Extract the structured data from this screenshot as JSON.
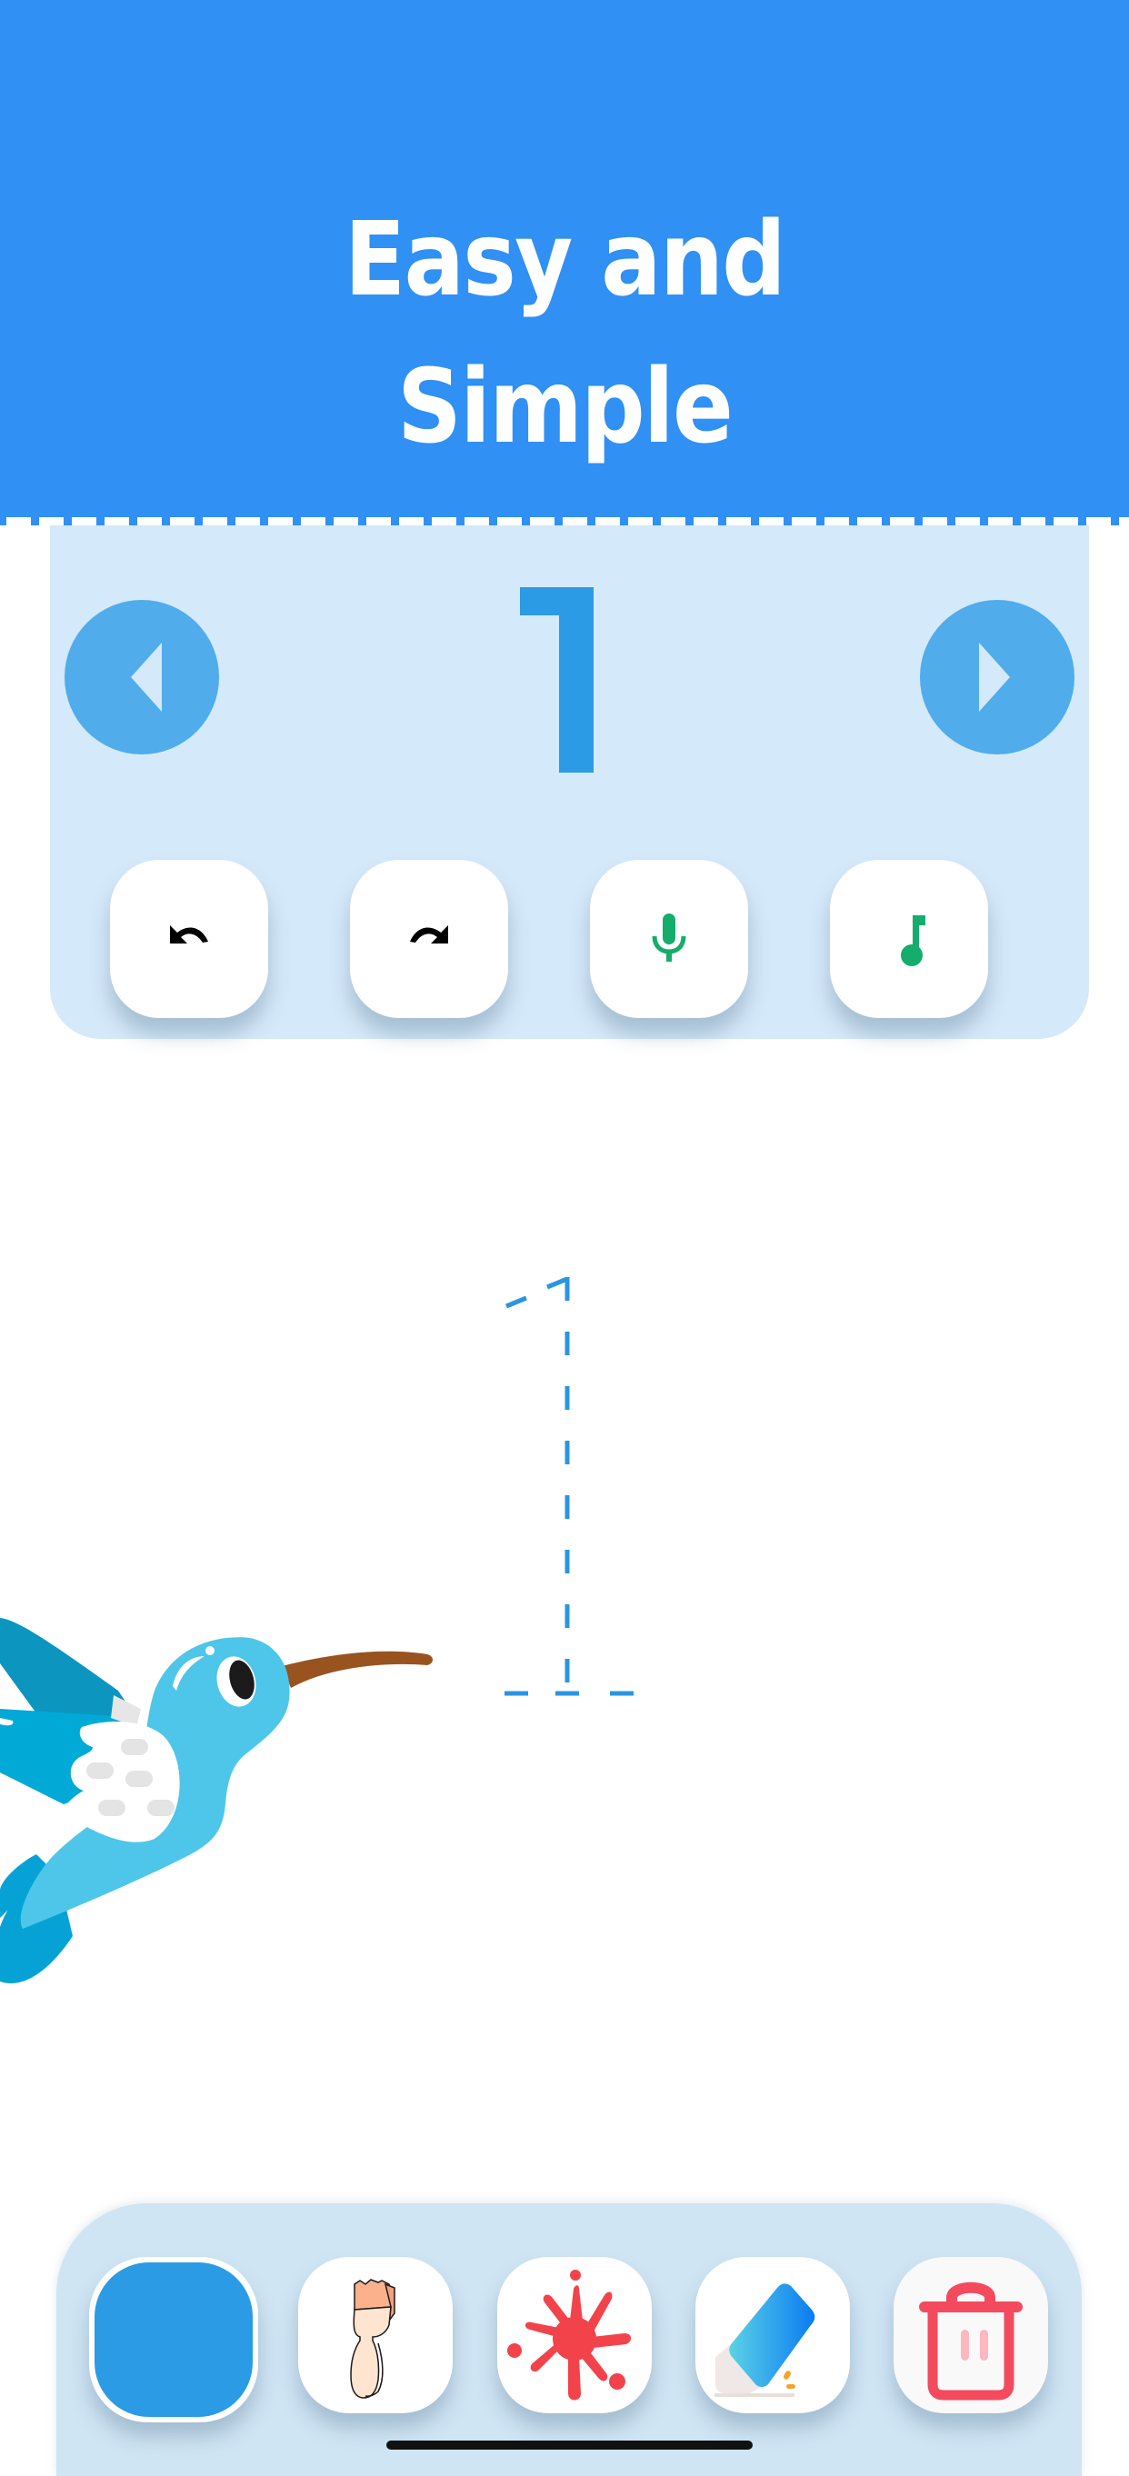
{
  "banner": {
    "title_line1": "Easy and",
    "title_line2": "Simple",
    "background_color": "#3090f4"
  },
  "number_panel": {
    "current_number": "1",
    "prev_button": {
      "icon": "triangle-left-icon",
      "label": "Previous number"
    },
    "next_button": {
      "icon": "triangle-right-icon",
      "label": "Next number"
    },
    "actions": [
      {
        "id": "undo",
        "icon": "undo-icon",
        "color": "#000000"
      },
      {
        "id": "redo",
        "icon": "redo-icon",
        "color": "#000000"
      },
      {
        "id": "voice",
        "icon": "microphone-icon",
        "color": "#14ad6b"
      },
      {
        "id": "sound",
        "icon": "music-note-icon",
        "color": "#14ad6b"
      }
    ]
  },
  "canvas": {
    "tracing_guide_digit": "1",
    "guide_color": "#2a95e0",
    "mascot": "hummingbird"
  },
  "toolbar": {
    "tools": [
      {
        "id": "color",
        "icon": "color-swatch",
        "color": "#2a9be4",
        "selected": true
      },
      {
        "id": "brush",
        "icon": "paintbrush-icon",
        "selected": false
      },
      {
        "id": "splash",
        "icon": "paint-splash-icon",
        "color": "#f2434b",
        "selected": false
      },
      {
        "id": "eraser",
        "icon": "eraser-icon",
        "selected": false
      },
      {
        "id": "clear",
        "icon": "trash-icon",
        "color": "#f44a5e",
        "selected": false
      }
    ]
  }
}
